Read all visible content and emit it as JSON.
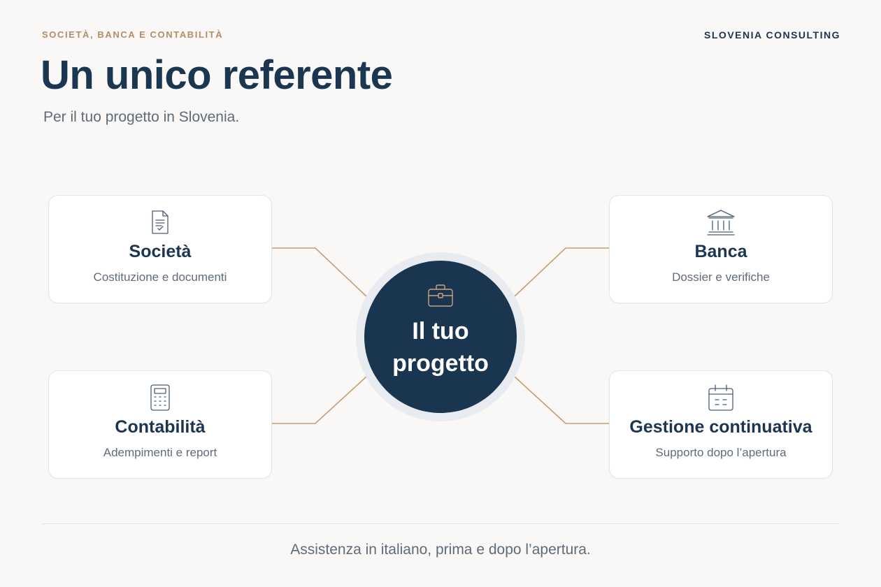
{
  "header": {
    "eyebrow": "SOCIETÀ, BANCA E CONTABILITÀ",
    "brand": "SLOVENIA CONSULTING",
    "title": "Un unico referente",
    "subtitle": "Per il tuo progetto in Slovenia."
  },
  "hub": {
    "label": "Il tuo\nprogetto",
    "icon": "briefcase-icon"
  },
  "cards": [
    {
      "title": "Società",
      "description": "Costituzione e documenti",
      "icon": "document-icon"
    },
    {
      "title": "Banca",
      "description": "Dossier e verifiche",
      "icon": "bank-icon"
    },
    {
      "title": "Contabilità",
      "description": "Adempimenti e report",
      "icon": "calculator-icon"
    },
    {
      "title": "Gestione continuativa",
      "description": "Supporto dopo l’apertura",
      "icon": "calendar-icon"
    }
  ],
  "footer": {
    "text": "Assistenza in italiano, prima e dopo l’apertura."
  },
  "colors": {
    "navy": "#1a3550",
    "accent": "#b48d64",
    "background": "#f9f8f6",
    "connector": "#c49d77"
  }
}
